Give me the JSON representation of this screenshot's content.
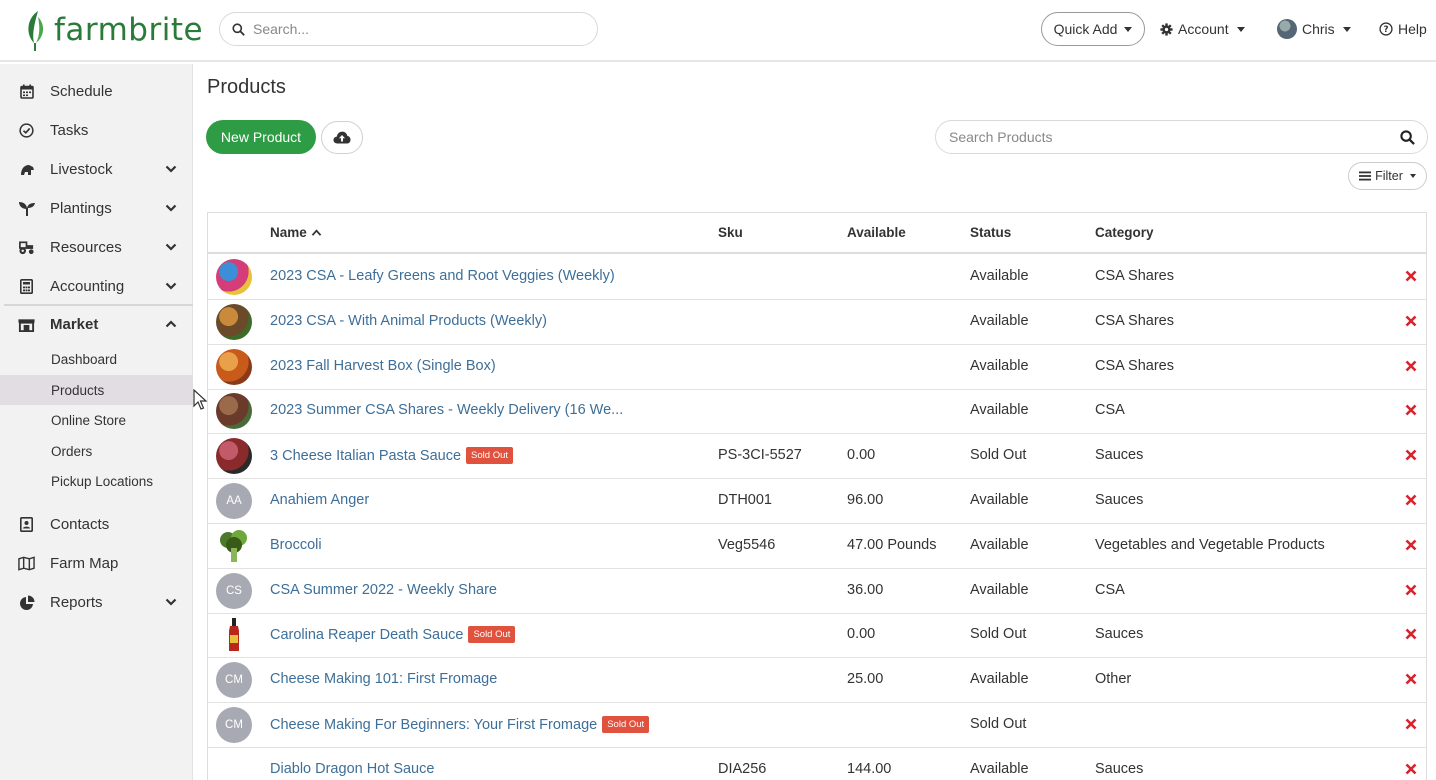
{
  "brand": {
    "name": "farmbrite",
    "color": "#2a7a3a"
  },
  "header": {
    "search_placeholder": "Search...",
    "quick_add": "Quick Add",
    "account": "Account",
    "user": "Chris",
    "help": "Help"
  },
  "sidebar": {
    "items": [
      {
        "label": "Schedule",
        "icon": "calendar-icon"
      },
      {
        "label": "Tasks",
        "icon": "check-circle-icon"
      },
      {
        "label": "Livestock",
        "icon": "livestock-icon"
      },
      {
        "label": "Plantings",
        "icon": "seedling-icon"
      },
      {
        "label": "Resources",
        "icon": "tractor-icon"
      },
      {
        "label": "Accounting",
        "icon": "calculator-icon"
      },
      {
        "label": "Market",
        "icon": "store-icon"
      },
      {
        "label": "Contacts",
        "icon": "address-book-icon"
      },
      {
        "label": "Farm Map",
        "icon": "map-icon"
      },
      {
        "label": "Reports",
        "icon": "pie-chart-icon"
      }
    ],
    "market_sub": [
      "Dashboard",
      "Products",
      "Online Store",
      "Orders",
      "Pickup Locations"
    ]
  },
  "main": {
    "title": "Products",
    "new_product": "New Product",
    "search_placeholder": "Search Products",
    "filter": "Filter",
    "columns": {
      "name": "Name",
      "sku": "Sku",
      "available": "Available",
      "status": "Status",
      "category": "Category"
    },
    "sold_out_badge": "Sold Out",
    "rows": [
      {
        "name": "2023 CSA - Leafy Greens and Root Veggies (Weekly)",
        "sku": "",
        "available": "",
        "status": "Available",
        "category": "CSA Shares",
        "sold_out": false,
        "thumb": "photo",
        "initials": ""
      },
      {
        "name": "2023 CSA - With Animal Products (Weekly)",
        "sku": "",
        "available": "",
        "status": "Available",
        "category": "CSA Shares",
        "sold_out": false,
        "thumb": "photo",
        "initials": ""
      },
      {
        "name": "2023 Fall Harvest Box (Single Box)",
        "sku": "",
        "available": "",
        "status": "Available",
        "category": "CSA Shares",
        "sold_out": false,
        "thumb": "photo",
        "initials": ""
      },
      {
        "name": "2023 Summer CSA Shares - Weekly Delivery (16 We...",
        "sku": "",
        "available": "",
        "status": "Available",
        "category": "CSA",
        "sold_out": false,
        "thumb": "photo",
        "initials": ""
      },
      {
        "name": "3 Cheese Italian Pasta Sauce",
        "sku": "PS-3CI-5527",
        "available": "0.00",
        "status": "Sold Out",
        "category": "Sauces",
        "sold_out": true,
        "thumb": "photo",
        "initials": ""
      },
      {
        "name": "Anahiem Anger",
        "sku": "DTH001",
        "available": "96.00",
        "status": "Available",
        "category": "Sauces",
        "sold_out": false,
        "thumb": "initials",
        "initials": "AA"
      },
      {
        "name": "Broccoli",
        "sku": "Veg5546",
        "available": "47.00 Pounds",
        "status": "Available",
        "category": "Vegetables and Vegetable Products",
        "sold_out": false,
        "thumb": "photo",
        "initials": ""
      },
      {
        "name": "CSA Summer 2022 - Weekly Share",
        "sku": "",
        "available": "36.00",
        "status": "Available",
        "category": "CSA",
        "sold_out": false,
        "thumb": "initials",
        "initials": "CS"
      },
      {
        "name": "Carolina Reaper Death Sauce",
        "sku": "",
        "available": "0.00",
        "status": "Sold Out",
        "category": "Sauces",
        "sold_out": true,
        "thumb": "photo",
        "initials": ""
      },
      {
        "name": "Cheese Making 101: First Fromage",
        "sku": "",
        "available": "25.00",
        "status": "Available",
        "category": "Other",
        "sold_out": false,
        "thumb": "initials",
        "initials": "CM"
      },
      {
        "name": "Cheese Making For Beginners: Your First Fromage",
        "sku": "",
        "available": "",
        "status": "Sold Out",
        "category": "",
        "sold_out": true,
        "thumb": "initials",
        "initials": "CM"
      },
      {
        "name": "Diablo Dragon Hot Sauce",
        "sku": "DIA256",
        "available": "144.00",
        "status": "Available",
        "category": "Sauces",
        "sold_out": false,
        "thumb": "none",
        "initials": ""
      }
    ]
  },
  "colors": {
    "primary_green": "#2e9c45",
    "link": "#3d6f99",
    "danger": "#e0523d",
    "delete_x": "#d9232d"
  }
}
